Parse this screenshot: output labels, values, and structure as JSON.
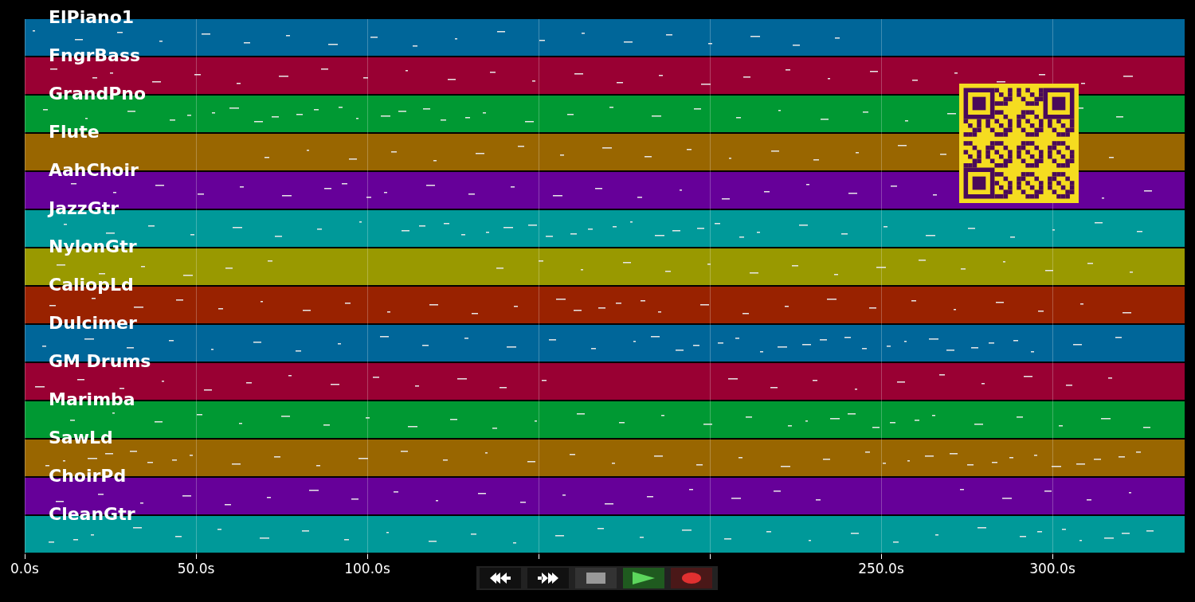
{
  "tracks": [
    {
      "name": "ElPiano1",
      "color": "#006699"
    },
    {
      "name": "FngrBass",
      "color": "#990033"
    },
    {
      "name": "GrandPno",
      "color": "#009933"
    },
    {
      "name": "Flute",
      "color": "#996600"
    },
    {
      "name": "AahChoir",
      "color": "#660099"
    },
    {
      "name": "JazzGtr",
      "color": "#009999"
    },
    {
      "name": "NylonGtr",
      "color": "#999900"
    },
    {
      "name": "CaliopLd",
      "color": "#992200"
    },
    {
      "name": "Dulcimer",
      "color": "#006699"
    },
    {
      "name": "GM Drums",
      "color": "#990033"
    },
    {
      "name": "Marimba",
      "color": "#009933"
    },
    {
      "name": "SawLd",
      "color": "#996600"
    },
    {
      "name": "ChoirPd",
      "color": "#660099"
    },
    {
      "name": "CleanGtr",
      "color": "#009999"
    }
  ],
  "axis": {
    "ticks": [
      "0.0s",
      "50.0s",
      "100.0s",
      "250.0s",
      "300.0s"
    ]
  },
  "controls": [
    {
      "kind": "rewind"
    },
    {
      "kind": "forward"
    },
    {
      "kind": "stop"
    },
    {
      "kind": "play"
    },
    {
      "kind": "record"
    }
  ]
}
